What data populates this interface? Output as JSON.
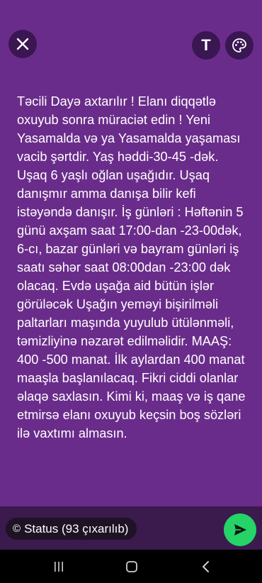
{
  "toolbar": {
    "close_icon": "close-icon",
    "text_label": "T",
    "palette_icon": "palette-icon"
  },
  "status": {
    "text": "Təcili Dayə axtarılır ! Elanı diqqətlə oxuyub sonra müraciət edin ! Yeni Yasamalda və ya Yasamalda yaşaması vacib şərtdir. Yaş həddi-30-45 -dək. Uşaq 6 yaşlı oğlan uşağıdır. Uşaq danışmır amma danışa bilir kefi istəyəndə danışır. İş günləri : Həftənin 5 günü axşam saat 17:00-dan -23-00dək, 6-cı, bazar günləri və bayram günləri iş saatı səhər saat 08:00dan -23:00 dək olacaq. Evdə uşağa aid bütün işlər görüləcək Uşağın yeməyi bişirilməli paltarları maşında yuyulub ütülənməli, təmizliyinə nəzarət edilməlidir. MAAŞ: 400 -500 manat. İlk aylardan 400 manat maaşla başlanılacaq. Fikri ciddi olanlar əlaqə saxlasın. Kimi ki, maaş və iş qane etmirsə elanı oxuyub keçsin boş sözləri ilə vaxtımı almasın.",
    "background_color": "#6a2c8a"
  },
  "composer": {
    "audience_icon": "circle-dashed-icon",
    "audience_label": "Status (93 çıxarılıb)",
    "send_icon": "send-icon",
    "send_color": "#25d366"
  },
  "navigation": {
    "recents_icon": "recents-icon",
    "home_icon": "home-icon",
    "back_icon": "back-icon"
  }
}
